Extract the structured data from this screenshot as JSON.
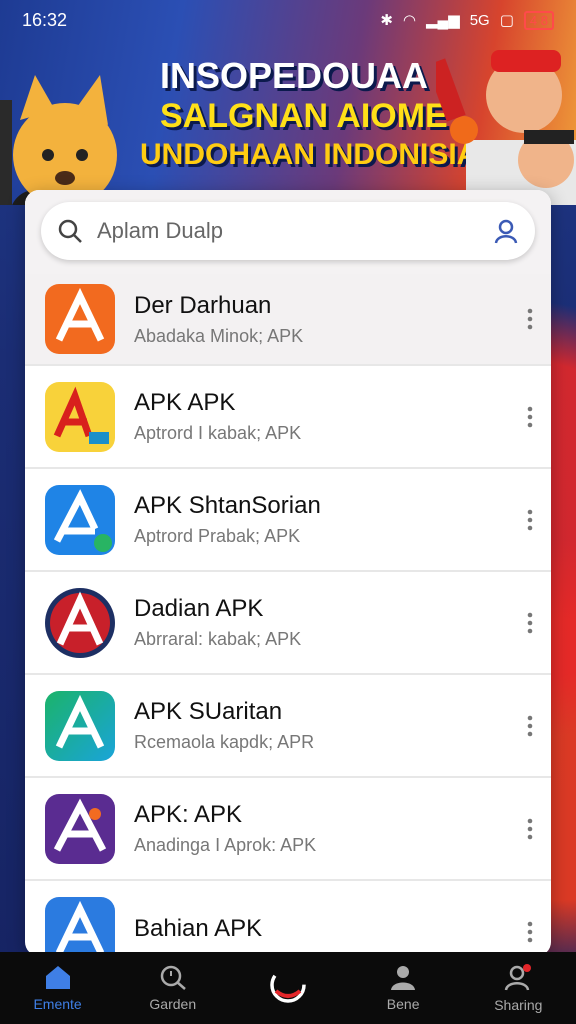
{
  "status": {
    "time": "16:32",
    "signal_text": "5G",
    "battery": "4 8"
  },
  "banner": {
    "line1": "INSOPEDOUAA",
    "line2": "SALGNAN AIOME",
    "line3": "UNDOHAAN INDONISIA"
  },
  "search": {
    "placeholder": "Aplam Dualp"
  },
  "apps": [
    {
      "title": "Der Darhuan",
      "subtitle": "Abadaka Minok; APK",
      "icon_color": "#f26a1f"
    },
    {
      "title": "APK APK",
      "subtitle": "Aptrord I kabak; APK",
      "icon_color": "#f8d23a"
    },
    {
      "title": "APK ShtanSorian",
      "subtitle": "Aptrord Prabak; APK",
      "icon_color": "#1f84e6"
    },
    {
      "title": "Dadian APK",
      "subtitle": "Abrraral: kabak; APK",
      "icon_color": "#1d2f63"
    },
    {
      "title": "APK SUaritan",
      "subtitle": "Rcemaola kapdk; APR",
      "icon_color": "#1bb36a"
    },
    {
      "title": "APK: APK",
      "subtitle": "Anadinga I Aprok: APK",
      "icon_color": "#5a2c91"
    },
    {
      "title": "Bahian APK",
      "subtitle": "",
      "icon_color": "#2b7be0"
    }
  ],
  "nav": [
    {
      "label": "Emente",
      "icon": "home-icon"
    },
    {
      "label": "Garden",
      "icon": "search-clock-icon"
    },
    {
      "label": "",
      "icon": "center-logo-icon"
    },
    {
      "label": "Bene",
      "icon": "profile-icon"
    },
    {
      "label": "Sharing",
      "icon": "sharing-icon"
    }
  ]
}
